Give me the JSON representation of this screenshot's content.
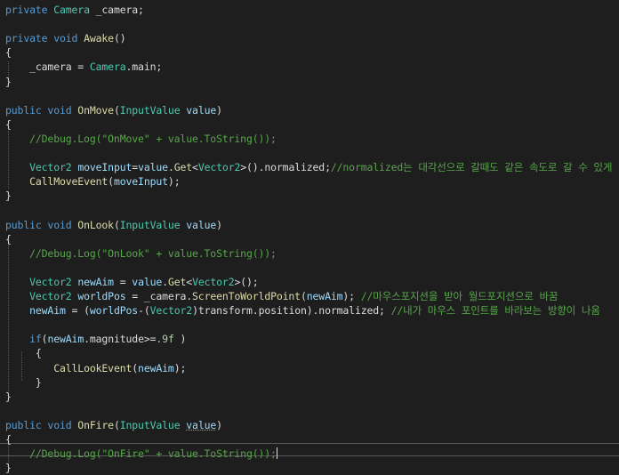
{
  "editor": {
    "colors": {
      "background": "#1e1e1e",
      "keyword": "#569cd6",
      "type": "#4ec9b0",
      "method": "#dcdcaa",
      "identifier": "#9cdcfe",
      "comment": "#57a64a",
      "string": "#d69d85",
      "number": "#b5cea8",
      "text": "#dcdcdc"
    },
    "lines": [
      {
        "tokens": [
          [
            "kw",
            "private "
          ],
          [
            "ty",
            "Camera"
          ],
          [
            "tx",
            " _camera;"
          ]
        ]
      },
      {
        "tokens": []
      },
      {
        "tokens": [
          [
            "kw",
            "private void "
          ],
          [
            "fn",
            "Awake"
          ],
          [
            "tx",
            "()"
          ]
        ]
      },
      {
        "tokens": [
          [
            "tx",
            "{"
          ]
        ]
      },
      {
        "tokens": [
          [
            "tx",
            "    _camera = "
          ],
          [
            "ty",
            "Camera"
          ],
          [
            "tx",
            ".main;"
          ]
        ]
      },
      {
        "tokens": [
          [
            "tx",
            "}"
          ]
        ]
      },
      {
        "tokens": []
      },
      {
        "tokens": [
          [
            "kw",
            "public void "
          ],
          [
            "fn",
            "OnMove"
          ],
          [
            "tx",
            "("
          ],
          [
            "ty",
            "InputValue"
          ],
          [
            "tx",
            " "
          ],
          [
            "id",
            "value"
          ],
          [
            "tx",
            ")"
          ]
        ]
      },
      {
        "tokens": [
          [
            "tx",
            "{"
          ]
        ]
      },
      {
        "tokens": [
          [
            "cm",
            "    //Debug.Log(\"OnMove\" + value.ToString());"
          ]
        ]
      },
      {
        "tokens": []
      },
      {
        "tokens": [
          [
            "tx",
            "    "
          ],
          [
            "ty",
            "Vector2"
          ],
          [
            "tx",
            " "
          ],
          [
            "id",
            "moveInput"
          ],
          [
            "tx",
            "="
          ],
          [
            "id",
            "value"
          ],
          [
            "tx",
            "."
          ],
          [
            "fn",
            "Get"
          ],
          [
            "tx",
            "<"
          ],
          [
            "ty",
            "Vector2"
          ],
          [
            "tx",
            ">().normalized;"
          ],
          [
            "cm",
            "//normalized는 대각선으로 갈때도 같은 속도로 갈 수 있게 한다."
          ]
        ]
      },
      {
        "tokens": [
          [
            "tx",
            "    "
          ],
          [
            "fn",
            "CallMoveEvent"
          ],
          [
            "tx",
            "("
          ],
          [
            "id",
            "moveInput"
          ],
          [
            "tx",
            ");"
          ]
        ]
      },
      {
        "tokens": [
          [
            "tx",
            "}"
          ]
        ]
      },
      {
        "tokens": []
      },
      {
        "tokens": [
          [
            "kw",
            "public void "
          ],
          [
            "fn",
            "OnLook"
          ],
          [
            "tx",
            "("
          ],
          [
            "ty",
            "InputValue"
          ],
          [
            "tx",
            " "
          ],
          [
            "id",
            "value"
          ],
          [
            "tx",
            ")"
          ]
        ]
      },
      {
        "tokens": [
          [
            "tx",
            "{"
          ]
        ]
      },
      {
        "tokens": [
          [
            "cm",
            "    //Debug.Log(\"OnLook\" + value.ToString());"
          ]
        ]
      },
      {
        "tokens": []
      },
      {
        "tokens": [
          [
            "tx",
            "    "
          ],
          [
            "ty",
            "Vector2"
          ],
          [
            "tx",
            " "
          ],
          [
            "id",
            "newAim"
          ],
          [
            "tx",
            " = "
          ],
          [
            "id",
            "value"
          ],
          [
            "tx",
            "."
          ],
          [
            "fn",
            "Get"
          ],
          [
            "tx",
            "<"
          ],
          [
            "ty",
            "Vector2"
          ],
          [
            "tx",
            ">();"
          ]
        ]
      },
      {
        "tokens": [
          [
            "tx",
            "    "
          ],
          [
            "ty",
            "Vector2"
          ],
          [
            "tx",
            " "
          ],
          [
            "id",
            "worldPos"
          ],
          [
            "tx",
            " = _camera."
          ],
          [
            "fn",
            "ScreenToWorldPoint"
          ],
          [
            "tx",
            "("
          ],
          [
            "id",
            "newAim"
          ],
          [
            "tx",
            "); "
          ],
          [
            "cm",
            "//마우스포지션을 받아 월드포지션으로 바꿈"
          ]
        ]
      },
      {
        "tokens": [
          [
            "tx",
            "    "
          ],
          [
            "id",
            "newAim"
          ],
          [
            "tx",
            " = ("
          ],
          [
            "id",
            "worldPos"
          ],
          [
            "tx",
            "-("
          ],
          [
            "ty",
            "Vector2"
          ],
          [
            "tx",
            ")transform.position).normalized; "
          ],
          [
            "cm",
            "//내가 마우스 포인트를 바라보는 방향이 나옴"
          ]
        ]
      },
      {
        "tokens": []
      },
      {
        "tokens": [
          [
            "tx",
            "    "
          ],
          [
            "kw",
            "if"
          ],
          [
            "tx",
            "("
          ],
          [
            "id",
            "newAim"
          ],
          [
            "tx",
            ".magnitude>="
          ],
          [
            "nm",
            ".9f"
          ],
          [
            "tx",
            " )"
          ]
        ]
      },
      {
        "tokens": [
          [
            "tx",
            "     {"
          ]
        ]
      },
      {
        "tokens": [
          [
            "tx",
            "        "
          ],
          [
            "fn",
            "CallLookEvent"
          ],
          [
            "tx",
            "("
          ],
          [
            "id",
            "newAim"
          ],
          [
            "tx",
            ");"
          ]
        ]
      },
      {
        "tokens": [
          [
            "tx",
            "     }"
          ]
        ]
      },
      {
        "tokens": [
          [
            "tx",
            "}"
          ]
        ]
      },
      {
        "tokens": []
      },
      {
        "tokens": [
          [
            "kw",
            "public void "
          ],
          [
            "fn",
            "OnFire"
          ],
          [
            "tx",
            "("
          ],
          [
            "ty",
            "InputValue"
          ],
          [
            "tx",
            " "
          ],
          [
            "sq",
            "value"
          ],
          [
            "tx",
            ")"
          ]
        ]
      },
      {
        "tokens": [
          [
            "tx",
            "{"
          ]
        ]
      },
      {
        "tokens": [
          [
            "cm",
            "    //Debug.Log(\"OnFire\" + value.ToString());"
          ],
          [
            "cur",
            ""
          ]
        ]
      },
      {
        "tokens": [
          [
            "tx",
            "}"
          ]
        ]
      }
    ]
  }
}
